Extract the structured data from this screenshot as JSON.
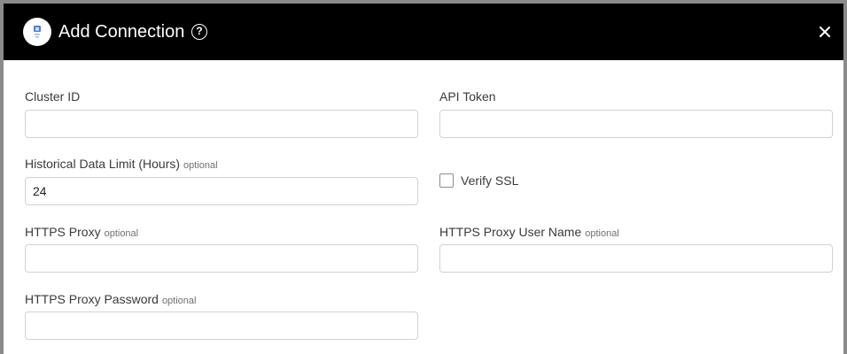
{
  "header": {
    "title": "Add Connection",
    "help_icon": "help-circle-icon",
    "close_icon": "close-icon",
    "logo_icon": "connector-logo-icon"
  },
  "form": {
    "cluster_id": {
      "label": "Cluster ID",
      "value": "",
      "placeholder": ""
    },
    "api_token": {
      "label": "API Token",
      "value": "",
      "placeholder": ""
    },
    "historical_limit": {
      "label": "Historical Data Limit (Hours)",
      "optional": "optional",
      "value": "24"
    },
    "verify_ssl": {
      "label": "Verify SSL",
      "checked": false
    },
    "https_proxy": {
      "label": "HTTPS Proxy",
      "optional": "optional",
      "value": ""
    },
    "https_proxy_user": {
      "label": "HTTPS Proxy User Name",
      "optional": "optional",
      "value": ""
    },
    "https_proxy_password": {
      "label": "HTTPS Proxy Password",
      "optional": "optional",
      "value": ""
    }
  },
  "colors": {
    "header_bg": "#000000",
    "header_text": "#ffffff",
    "input_border": "#d2d2d2",
    "label_text": "#3a3a3a",
    "optional_text": "#707070"
  }
}
